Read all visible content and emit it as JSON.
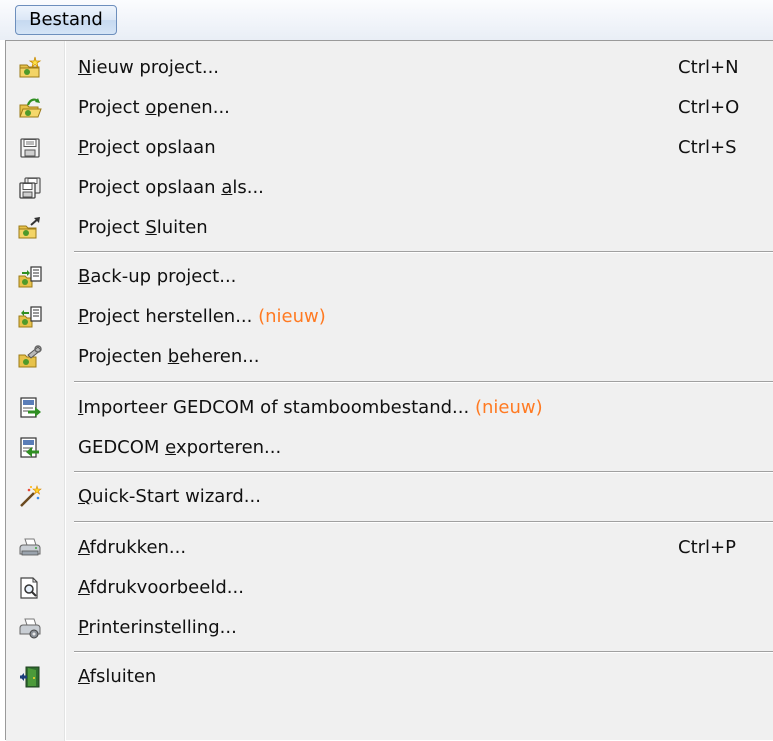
{
  "menubar": {
    "title": "Bestand"
  },
  "menu": {
    "items": [
      {
        "id": "nieuw",
        "pre": "",
        "ul": "N",
        "post": "ieuw project...",
        "badge": "",
        "shortcut": "Ctrl+N",
        "icon": "new-project-icon"
      },
      {
        "id": "openen",
        "pre": "Project ",
        "ul": "o",
        "post": "penen...",
        "badge": "",
        "shortcut": "Ctrl+O",
        "icon": "open-project-icon"
      },
      {
        "id": "opslaan",
        "pre": "",
        "ul": "P",
        "post": "roject opslaan",
        "badge": "",
        "shortcut": "Ctrl+S",
        "icon": "save-icon"
      },
      {
        "id": "opslaan-als",
        "pre": "Project opslaan ",
        "ul": "a",
        "post": "ls...",
        "badge": "",
        "shortcut": "",
        "icon": "save-as-icon"
      },
      {
        "id": "sluiten",
        "pre": "Project ",
        "ul": "S",
        "post": "luiten",
        "badge": "",
        "shortcut": "",
        "icon": "close-project-icon"
      },
      {
        "id": "backup",
        "pre": "",
        "ul": "B",
        "post": "ack-up project...",
        "badge": "",
        "shortcut": "",
        "icon": "backup-icon"
      },
      {
        "id": "herstellen",
        "pre": "",
        "ul": "P",
        "post": "roject herstellen... ",
        "badge": "(nieuw)",
        "shortcut": "",
        "icon": "restore-icon"
      },
      {
        "id": "beheren",
        "pre": "Projecten ",
        "ul": "b",
        "post": "eheren...",
        "badge": "",
        "shortcut": "",
        "icon": "manage-projects-icon"
      },
      {
        "id": "importeer",
        "pre": "",
        "ul": "I",
        "post": "mporteer GEDCOM of stamboombestand... ",
        "badge": "(nieuw)",
        "shortcut": "",
        "icon": "import-icon"
      },
      {
        "id": "exporteren",
        "pre": "GEDCOM ",
        "ul": "e",
        "post": "xporteren...",
        "badge": "",
        "shortcut": "",
        "icon": "export-icon"
      },
      {
        "id": "wizard",
        "pre": "",
        "ul": "Q",
        "post": "uick-Start wizard...",
        "badge": "",
        "shortcut": "",
        "icon": "wizard-wand-icon"
      },
      {
        "id": "afdrukken",
        "pre": "",
        "ul": "A",
        "post": "fdrukken...",
        "badge": "",
        "shortcut": "Ctrl+P",
        "icon": "printer-icon"
      },
      {
        "id": "voorbeeld",
        "pre": "",
        "ul": "A",
        "post": "fdrukvoorbeeld...",
        "badge": "",
        "shortcut": "",
        "icon": "print-preview-icon"
      },
      {
        "id": "printerinstelling",
        "pre": "",
        "ul": "P",
        "post": "rinterinstelling...",
        "badge": "",
        "shortcut": "",
        "icon": "printer-settings-icon"
      },
      {
        "id": "afsluiten",
        "pre": "",
        "ul": "A",
        "post": "fsluiten",
        "badge": "",
        "shortcut": "",
        "icon": "exit-icon"
      }
    ]
  },
  "colors": {
    "badge": "#ff7a22",
    "menu_bg": "#f0f0f0",
    "menubar_button_border": "#6d8fbd"
  }
}
